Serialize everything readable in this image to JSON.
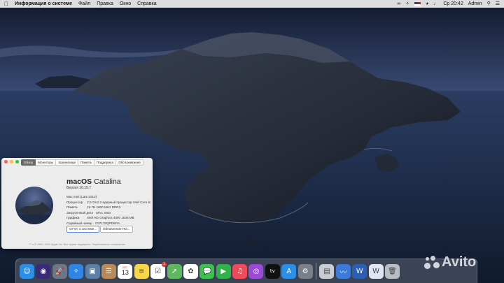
{
  "menubar": {
    "app_name": "Информация о системе",
    "items": [
      "Файл",
      "Правка",
      "Окно",
      "Справка"
    ],
    "clock": "Ср 20:42",
    "user": "Admin"
  },
  "about_window": {
    "tabs": [
      "Обзор",
      "Мониторы",
      "Хранилище",
      "Память",
      "Поддержка",
      "Обслуживание"
    ],
    "active_tab": "Обзор",
    "os_name_bold": "macOS",
    "os_name_light": "Catalina",
    "version": "Версия 10.15.7",
    "specs": [
      {
        "label": "Mac mini (Late 2012)",
        "value": ""
      },
      {
        "label": "Процессор",
        "value": "2,5 GHz 2-ядерный процессор Intel Core i5"
      },
      {
        "label": "Память",
        "value": "16 ГБ 1600 MHz DDR3"
      },
      {
        "label": "Загрузочный диск",
        "value": "MAC SSD"
      },
      {
        "label": "Графика",
        "value": "Intel HD Graphics 4000 1536 МБ"
      },
      {
        "label": "Серийный номер",
        "value": "C07L78QPDWYL"
      }
    ],
    "buttons": {
      "report": "Отчет о системе...",
      "update": "Обновление ПО..."
    },
    "copyright": "™ и © 1983–2020 Apple Inc. Все права защищены. Лицензионное соглашение"
  },
  "dock": {
    "apps": [
      {
        "name": "finder-icon",
        "glyph": "☺",
        "bg": "#2b8fe6"
      },
      {
        "name": "siri-icon",
        "glyph": "◉",
        "bg": "#3a2a7a"
      },
      {
        "name": "launchpad-icon",
        "glyph": "🚀",
        "bg": "#6c7684"
      },
      {
        "name": "safari-icon",
        "glyph": "✧",
        "bg": "#2f84e4"
      },
      {
        "name": "photo-preview-icon",
        "glyph": "▣",
        "bg": "#5c7fa8"
      },
      {
        "name": "contacts-icon",
        "glyph": "☰",
        "bg": "#b88a55"
      },
      {
        "name": "calendar-icon",
        "glyph": "",
        "bg": "#ffffff"
      },
      {
        "name": "notes-icon",
        "glyph": "≡",
        "bg": "#f7d84a"
      },
      {
        "name": "reminders-icon",
        "glyph": "☑",
        "bg": "#ffffff"
      },
      {
        "name": "maps-icon",
        "glyph": "➚",
        "bg": "#5fb85f"
      },
      {
        "name": "photos-icon",
        "glyph": "✿",
        "bg": "#ffffff"
      },
      {
        "name": "messages-icon",
        "glyph": "💬",
        "bg": "#3ac24a"
      },
      {
        "name": "facetime-icon",
        "glyph": "▶",
        "bg": "#30b14a"
      },
      {
        "name": "music-icon",
        "glyph": "♫",
        "bg": "#f04a5a"
      },
      {
        "name": "podcasts-icon",
        "glyph": "◎",
        "bg": "#9a4ad4"
      },
      {
        "name": "tv-icon",
        "glyph": "tv",
        "bg": "#111111"
      },
      {
        "name": "app-store-icon",
        "glyph": "A",
        "bg": "#2b8fe6"
      },
      {
        "name": "system-preferences-icon",
        "glyph": "⚙",
        "bg": "#7a7f88"
      }
    ],
    "calendar": {
      "month": "ОКТ.",
      "day": "13"
    },
    "reminders_badge": "2",
    "recent": [
      {
        "name": "sysinfo-icon",
        "glyph": "▤",
        "bg": "#c8ccd2"
      },
      {
        "name": "network-utility-icon",
        "glyph": "〰",
        "bg": "#3a7ad8"
      },
      {
        "name": "word-icon",
        "glyph": "W",
        "bg": "#2b5fb4"
      },
      {
        "name": "word-doc-icon",
        "glyph": "W",
        "bg": "#dfe6f2"
      },
      {
        "name": "trash-icon",
        "glyph": "🗑",
        "bg": "#b9bec6"
      }
    ]
  },
  "watermark": "Avito"
}
